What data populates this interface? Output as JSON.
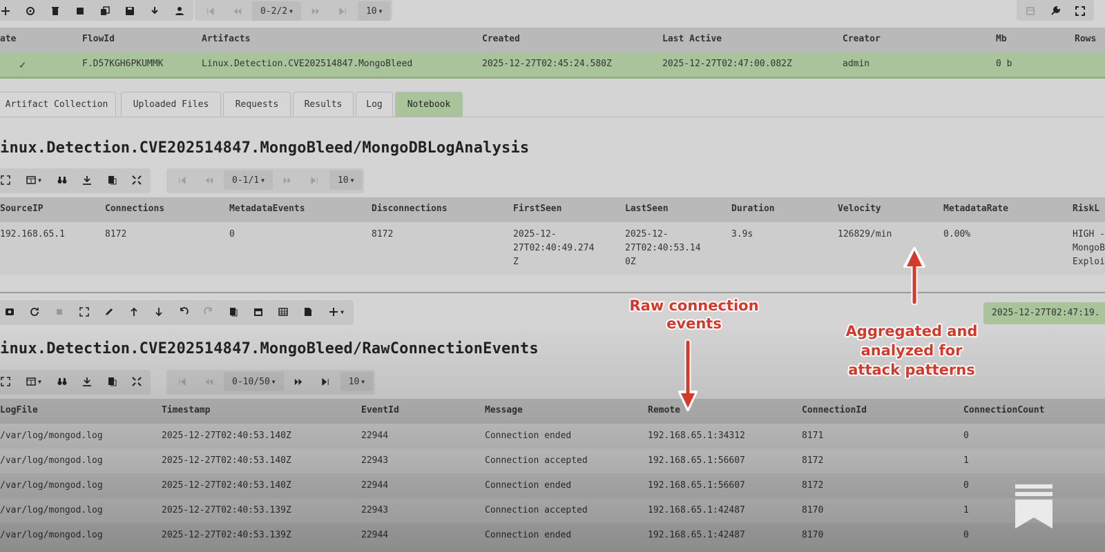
{
  "top_toolbar": {
    "icons": [
      "plus-icon",
      "crosshair-icon",
      "trash-icon",
      "stop-icon",
      "copy-icon",
      "save-icon",
      "download-icon",
      "user-icon"
    ],
    "pager_label": "0-2/2",
    "page_size": "10",
    "right_icons": [
      "archive-icon",
      "wrench-icon",
      "fullscreen-icon"
    ]
  },
  "flows_table": {
    "headers": [
      "ate",
      "FlowId",
      "Artifacts",
      "Created",
      "Last Active",
      "Creator",
      "Mb",
      "Rows"
    ],
    "row": {
      "state": "✓",
      "flow_id": "F.D57KGH6PKUMMK",
      "artifacts": "Linux.Detection.CVE202514847.MongoBleed",
      "created": "2025-12-27T02:45:24.580Z",
      "last_active": "2025-12-27T02:47:00.082Z",
      "creator": "admin",
      "mb": "0 b",
      "rows": ""
    },
    "selected_color": "#a9c49b"
  },
  "tabs": [
    "Artifact Collection",
    "Uploaded Files",
    "Requests",
    "Results",
    "Log",
    "Notebook"
  ],
  "active_tab": "Notebook",
  "analysis": {
    "title": "inux.Detection.CVE202514847.MongoBleed/MongoDBLogAnalysis",
    "pager_label": "0-1/1",
    "page_size": "10",
    "headers": [
      "SourceIP",
      "Connections",
      "MetadataEvents",
      "Disconnections",
      "FirstSeen",
      "LastSeen",
      "Duration",
      "Velocity",
      "MetadataRate",
      "RiskL"
    ],
    "row": {
      "source_ip": "192.168.65.1",
      "connections": "8172",
      "metadata_events": "0",
      "disconnections": "8172",
      "first_seen": [
        "2025-12-",
        "27T02:40:49.274",
        "Z"
      ],
      "last_seen": [
        "2025-12-",
        "27T02:40:53.14",
        "0Z"
      ],
      "duration": "3.9s",
      "velocity": "126829/min",
      "metadata_rate": "0.00%",
      "risk": [
        "HIGH -",
        "MongoB",
        "Exploi"
      ]
    }
  },
  "cell_toolbar": {
    "timestamp_badge": "2025-12-27T02:47:19."
  },
  "raw_events": {
    "title": "inux.Detection.CVE202514847.MongoBleed/RawConnectionEvents",
    "pager_label": "0-10/50",
    "page_size": "10",
    "headers": [
      "LogFile",
      "Timestamp",
      "EventId",
      "Message",
      "Remote",
      "ConnectionId",
      "ConnectionCount"
    ],
    "rows": [
      [
        "/var/log/mongod.log",
        "2025-12-27T02:40:53.140Z",
        "22944",
        "Connection ended",
        "192.168.65.1:34312",
        "8171",
        "0"
      ],
      [
        "/var/log/mongod.log",
        "2025-12-27T02:40:53.140Z",
        "22943",
        "Connection accepted",
        "192.168.65.1:56607",
        "8172",
        "1"
      ],
      [
        "/var/log/mongod.log",
        "2025-12-27T02:40:53.140Z",
        "22944",
        "Connection ended",
        "192.168.65.1:56607",
        "8172",
        "0"
      ],
      [
        "/var/log/mongod.log",
        "2025-12-27T02:40:53.139Z",
        "22943",
        "Connection accepted",
        "192.168.65.1:42487",
        "8170",
        "1"
      ],
      [
        "/var/log/mongod.log",
        "2025-12-27T02:40:53.139Z",
        "22944",
        "Connection ended",
        "192.168.65.1:42487",
        "8170",
        "0"
      ]
    ]
  },
  "annotations": {
    "raw": [
      "Raw connection",
      "events"
    ],
    "aggregated": [
      "Aggregated and",
      "analyzed for",
      "attack patterns"
    ],
    "color": "#d6382c"
  }
}
